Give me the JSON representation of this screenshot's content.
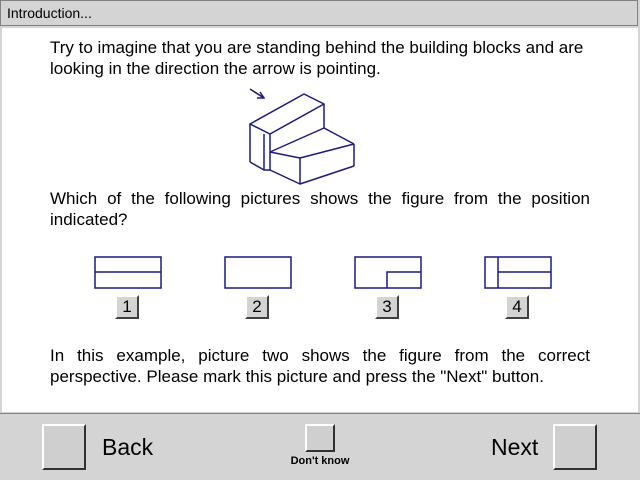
{
  "window": {
    "title": "Introduction..."
  },
  "instructions": {
    "paragraph1": "Try to imagine that you are standing behind the building blocks and are looking in the direction the arrow is pointing.",
    "question": "Which of the following pictures shows the figure from the position indicated?",
    "example": "In this example, picture two shows the figure from the correct perspective. Please mark this picture and press the \"Next\" button."
  },
  "options": [
    {
      "label": "1",
      "icon": "two-stacked-rectangles"
    },
    {
      "label": "2",
      "icon": "single-rectangle"
    },
    {
      "label": "3",
      "icon": "rectangle-with-corner-step"
    },
    {
      "label": "4",
      "icon": "rectangle-with-side-and-horizontal-divider"
    }
  ],
  "navigation": {
    "back_label": "Back",
    "next_label": "Next",
    "dont_know_label": "Don't know"
  },
  "colors": {
    "figure_stroke": "#1a1a80",
    "chrome": "#d4d4d4",
    "content_bg": "#ffffff"
  }
}
